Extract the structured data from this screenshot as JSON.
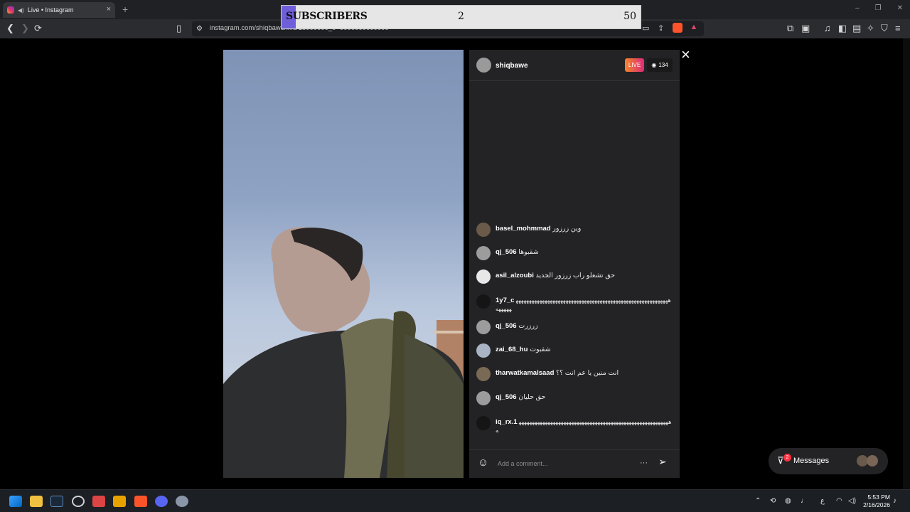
{
  "browser": {
    "tab_title": "Live • Instagram",
    "tab_close": "×",
    "new_tab": "+",
    "url": "instagram.com/shiqbawe/live/18000000_0=0000000000000",
    "window_controls": [
      "–",
      "❐",
      "✕"
    ]
  },
  "subscriber_goal": {
    "label": "SUBSCRIBERS",
    "current": "2",
    "goal": "50",
    "progress_fraction": 0.04,
    "bar_color": "#6e5ed9"
  },
  "live": {
    "host": "shiqbawe",
    "live_label": "LIVE",
    "viewer_count": "134",
    "close_icon": "×",
    "comments": [
      {
        "user": "basel_mohmmad",
        "text": "وين زرزور"
      },
      {
        "user": "qj_506",
        "text": "شقبوها"
      },
      {
        "user": "asil_alzoubi",
        "text": "حق تشغلو راب زرزور الجديد"
      },
      {
        "user": "1y7_c",
        "text": "ههههههههههههههههههههههههههههههههههههههههههههههههههههههههههههههههه"
      },
      {
        "user": "qj_506",
        "text": "زرزرت"
      },
      {
        "user": "zai_68_hu",
        "text": "شقبوت"
      },
      {
        "user": "tharwatkamalsaad",
        "text": "انت منين يا عم انت ؟؟"
      },
      {
        "user": "qj_506",
        "text": "حق حليان"
      },
      {
        "user": "iq_rx.1",
        "text": "ههههههههههههههههههههههههههههههههههههههههههههههههههههههههههه"
      }
    ],
    "comment_placeholder": "Add a comment...",
    "more_icon": "···"
  },
  "messages": {
    "label": "Messages",
    "badge": "2"
  },
  "taskbar": {
    "time": "5:53 PM",
    "date": "2/16/2026",
    "lang": "ع"
  },
  "colors": {
    "panel": "#232325",
    "live_gradient_start": "#f58529",
    "live_gradient_end": "#dd2a7b",
    "badge_red": "#ff3040"
  }
}
